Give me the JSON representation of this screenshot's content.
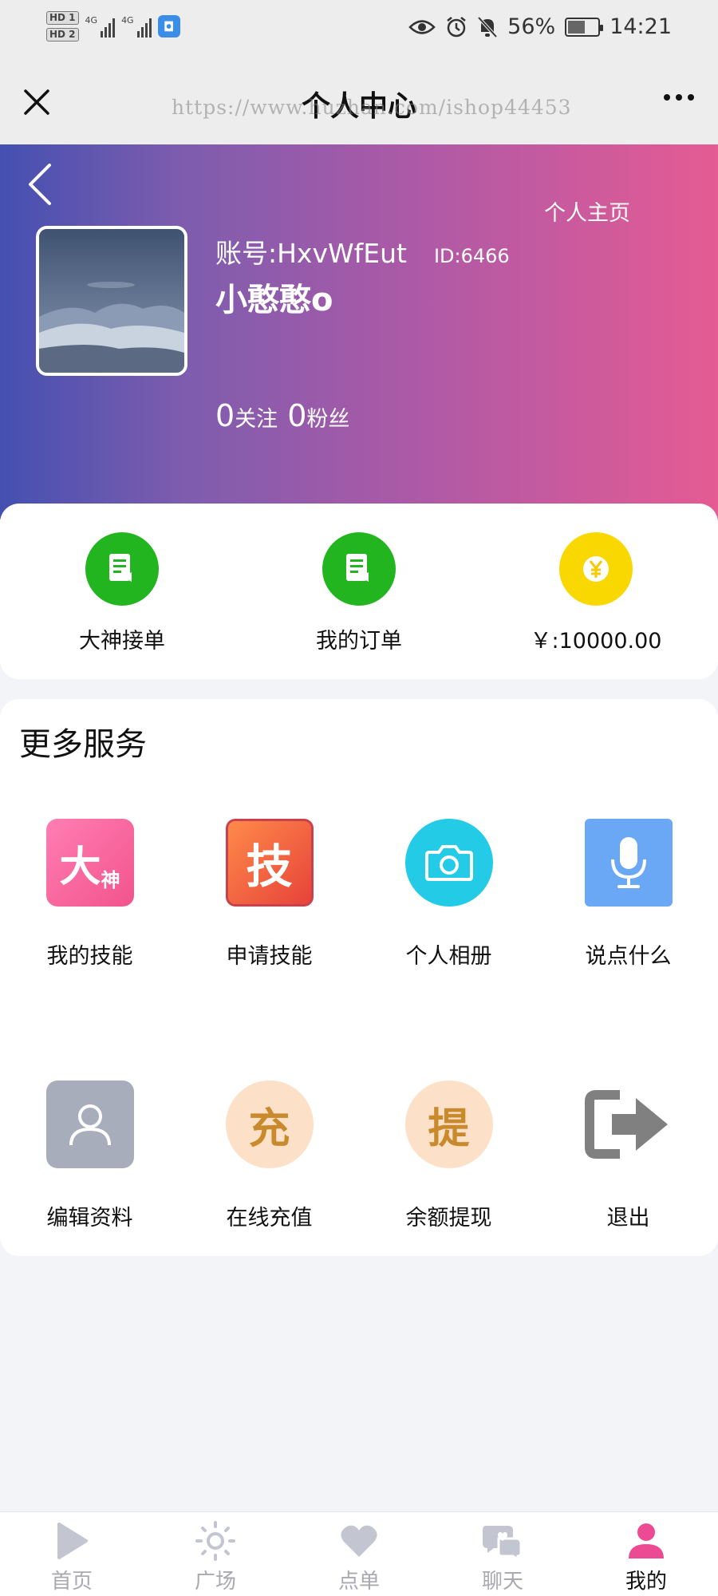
{
  "status_bar": {
    "hd1": "HD 1",
    "hd2": "HD 2",
    "signal1_label": "4G",
    "signal2_label": "4G",
    "battery_percent": "56%",
    "battery_level": 0.56,
    "time": "14:21"
  },
  "title_bar": {
    "title": "个人中心",
    "watermark": "https://www.huzhan.com/ishop44453"
  },
  "profile": {
    "home_link": "个人主页",
    "account_label": "账号:HxvWfEut",
    "id_label": "ID:6466",
    "nickname": "小憨憨o",
    "following_count": "0",
    "following_label": "关注",
    "followers_count": "0",
    "followers_label": "粉丝"
  },
  "quick_actions": [
    {
      "label": "大神接单",
      "icon": "document-icon",
      "color": "#22b51f"
    },
    {
      "label": "我的订单",
      "icon": "document-icon",
      "color": "#22b51f"
    },
    {
      "label": "￥:10000.00",
      "icon": "yen-coin-icon",
      "color": "#f8d800"
    }
  ],
  "services": {
    "title": "更多服务",
    "items": [
      {
        "label": "我的技能",
        "icon": "dashen-badge-icon",
        "glyph": "大",
        "glyph_small": "神"
      },
      {
        "label": "申请技能",
        "icon": "skill-badge-icon",
        "glyph": "技"
      },
      {
        "label": "个人相册",
        "icon": "camera-icon"
      },
      {
        "label": "说点什么",
        "icon": "microphone-icon"
      },
      {
        "label": "编辑资料",
        "icon": "user-icon"
      },
      {
        "label": "在线充值",
        "icon": "recharge-icon",
        "glyph": "充"
      },
      {
        "label": "余额提现",
        "icon": "withdraw-icon",
        "glyph": "提"
      },
      {
        "label": "退出",
        "icon": "logout-icon"
      }
    ]
  },
  "bottom_nav": [
    {
      "label": "首页",
      "icon": "play-icon",
      "active": false
    },
    {
      "label": "广场",
      "icon": "sun-icon",
      "active": false
    },
    {
      "label": "点单",
      "icon": "heart-icon",
      "active": false
    },
    {
      "label": "聊天",
      "icon": "chat-bubble-icon",
      "active": false
    },
    {
      "label": "我的",
      "icon": "user-icon",
      "active": true
    }
  ],
  "colors": {
    "accent_pink": "#ec4b94",
    "nav_inactive": "#c3c6d0"
  }
}
